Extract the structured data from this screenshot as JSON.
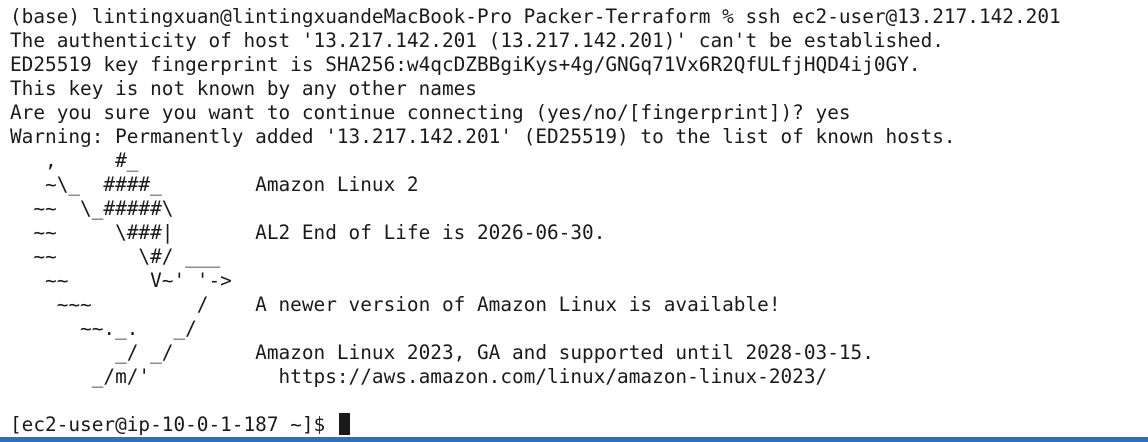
{
  "terminal": {
    "lines": [
      "(base) lintingxuan@lintingxuandeMacBook-Pro Packer-Terraform % ssh ec2-user@13.217.142.201",
      "The authenticity of host '13.217.142.201 (13.217.142.201)' can't be established.",
      "ED25519 key fingerprint is SHA256:w4qcDZBBgiKys+4g/GNGq71Vx6R2QfULfjHQD4ij0GY.",
      "This key is not known by any other names",
      "Are you sure you want to continue connecting (yes/no/[fingerprint])? yes",
      "Warning: Permanently added '13.217.142.201' (ED25519) to the list of known hosts.",
      "   ,     #_",
      "   ~\\_  ####_        Amazon Linux 2",
      "  ~~  \\_#####\\",
      "  ~~     \\###|       AL2 End of Life is 2026-06-30.",
      "  ~~       \\#/ ___",
      "   ~~       V~' '->",
      "    ~~~         /    A newer version of Amazon Linux is available!",
      "      ~~._.   _/",
      "         _/ _/       Amazon Linux 2023, GA and supported until 2028-03-15.",
      "       _/m/'           https://aws.amazon.com/linux/amazon-linux-2023/",
      ""
    ],
    "prompt": "[ec2-user@ip-10-0-1-187 ~]$ "
  },
  "colors": {
    "background": "#ffffff",
    "text": "#1a1a1a",
    "bottom_bar": "#2f6fc0"
  }
}
